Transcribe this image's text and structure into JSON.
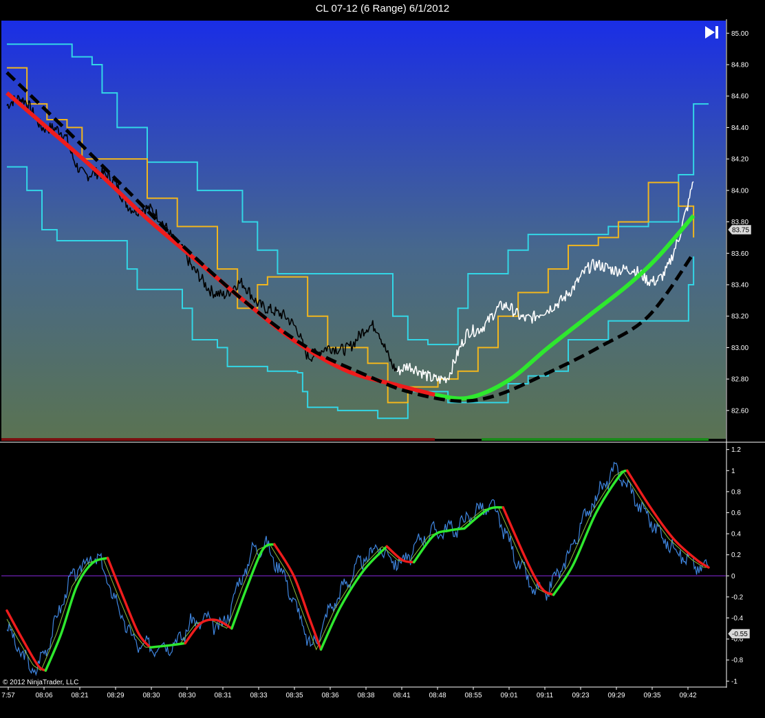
{
  "window": {
    "title": "CL 07-12 (6 Range)  6/1/2012"
  },
  "copyright": "© 2012 NinjaTrader, LLC",
  "colors": {
    "cyan": "#33d6e6",
    "orange": "#f2b61d",
    "red": "#ee1c1c",
    "green": "#2ee82e",
    "black_dash": "#000000",
    "blue_osc": "#3f86e0",
    "zero_line": "#8a2be2"
  },
  "chart_data": [
    {
      "type": "line",
      "panel": "price",
      "yticks": [
        "85.00",
        "84.80",
        "84.60",
        "84.40",
        "84.20",
        "84.00",
        "83.80",
        "83.60",
        "83.40",
        "83.20",
        "83.00",
        "82.80",
        "82.60"
      ],
      "ylim": [
        82.42,
        85.08
      ],
      "current_label": "83.75",
      "current_value": 83.75,
      "series": [
        {
          "color_key": "red",
          "role": "trend",
          "points": [
            [
              0,
              84.62
            ],
            [
              40,
              84.4
            ],
            [
              90,
              84.12
            ],
            [
              140,
              83.82
            ],
            [
              190,
              83.55
            ],
            [
              240,
              83.28
            ],
            [
              290,
              83.03
            ],
            [
              340,
              82.85
            ],
            [
              390,
              82.76
            ],
            [
              427,
              82.7
            ]
          ]
        },
        {
          "color_key": "green",
          "role": "trend",
          "points": [
            [
              427,
              82.7
            ],
            [
              460,
              82.68
            ],
            [
              500,
              82.79
            ],
            [
              540,
              83.0
            ],
            [
              580,
              83.2
            ],
            [
              620,
              83.4
            ],
            [
              650,
              83.58
            ],
            [
              685,
              83.84
            ]
          ]
        },
        {
          "color_key": "black_dash",
          "role": "trend",
          "points": [
            [
              0,
              84.75
            ],
            [
              60,
              84.38
            ],
            [
              120,
              84.0
            ],
            [
              180,
              83.62
            ],
            [
              240,
              83.28
            ],
            [
              300,
              83.0
            ],
            [
              360,
              82.82
            ],
            [
              400,
              82.72
            ],
            [
              450,
              82.66
            ],
            [
              490,
              82.7
            ],
            [
              540,
              82.84
            ],
            [
              590,
              83.0
            ],
            [
              640,
              83.2
            ],
            [
              685,
              83.6
            ]
          ]
        },
        {
          "color_key": "cyan",
          "role": "upper",
          "points": [
            [
              0,
              84.93
            ],
            [
              60,
              84.93
            ],
            [
              65,
              84.85
            ],
            [
              85,
              84.8
            ],
            [
              95,
              84.62
            ],
            [
              110,
              84.4
            ],
            [
              140,
              84.18
            ],
            [
              190,
              84.0
            ],
            [
              235,
              83.8
            ],
            [
              250,
              83.62
            ],
            [
              270,
              83.47
            ],
            [
              370,
              83.47
            ],
            [
              385,
              83.2
            ],
            [
              400,
              83.05
            ],
            [
              420,
              83.02
            ],
            [
              440,
              83.02
            ],
            [
              450,
              83.25
            ],
            [
              460,
              83.47
            ],
            [
              500,
              83.62
            ],
            [
              520,
              83.72
            ],
            [
              600,
              83.77
            ],
            [
              640,
              83.8
            ],
            [
              670,
              84.1
            ],
            [
              685,
              84.55
            ],
            [
              700,
              84.55
            ]
          ]
        },
        {
          "color_key": "cyan",
          "role": "lower",
          "points": [
            [
              0,
              84.15
            ],
            [
              20,
              84.0
            ],
            [
              35,
              83.75
            ],
            [
              50,
              83.68
            ],
            [
              110,
              83.68
            ],
            [
              120,
              83.5
            ],
            [
              130,
              83.37
            ],
            [
              160,
              83.37
            ],
            [
              175,
              83.25
            ],
            [
              185,
              83.05
            ],
            [
              210,
              83.0
            ],
            [
              220,
              82.88
            ],
            [
              260,
              82.85
            ],
            [
              290,
              82.84
            ],
            [
              295,
              82.72
            ],
            [
              300,
              82.62
            ],
            [
              330,
              82.6
            ],
            [
              370,
              82.55
            ],
            [
              390,
              82.55
            ],
            [
              400,
              82.72
            ],
            [
              440,
              82.65
            ],
            [
              480,
              82.65
            ],
            [
              500,
              82.77
            ],
            [
              520,
              82.82
            ],
            [
              540,
              82.85
            ],
            [
              560,
              83.05
            ],
            [
              600,
              83.17
            ],
            [
              660,
              83.17
            ],
            [
              680,
              83.4
            ],
            [
              685,
              83.58
            ]
          ]
        },
        {
          "color_key": "orange",
          "role": "band",
          "points": [
            [
              0,
              84.78
            ],
            [
              20,
              84.55
            ],
            [
              40,
              84.45
            ],
            [
              60,
              84.4
            ],
            [
              75,
              84.2
            ],
            [
              120,
              84.2
            ],
            [
              140,
              83.95
            ],
            [
              170,
              83.77
            ],
            [
              190,
              83.77
            ],
            [
              210,
              83.5
            ],
            [
              230,
              83.25
            ],
            [
              250,
              83.4
            ],
            [
              260,
              83.45
            ],
            [
              280,
              83.45
            ],
            [
              300,
              83.2
            ],
            [
              320,
              83.0
            ],
            [
              360,
              82.9
            ],
            [
              380,
              82.65
            ],
            [
              400,
              82.75
            ],
            [
              430,
              82.8
            ],
            [
              450,
              82.85
            ],
            [
              470,
              83.0
            ],
            [
              490,
              83.2
            ],
            [
              510,
              83.35
            ],
            [
              540,
              83.5
            ],
            [
              560,
              83.65
            ],
            [
              590,
              83.7
            ],
            [
              610,
              83.8
            ],
            [
              640,
              84.05
            ],
            [
              660,
              84.05
            ],
            [
              670,
              83.9
            ],
            [
              685,
              83.7
            ]
          ]
        }
      ]
    },
    {
      "type": "line",
      "panel": "oscillator",
      "yticks": [
        "1.2",
        "1",
        "0.8",
        "0.6",
        "0.4",
        "0.2",
        "0",
        "-0.2",
        "-0.4",
        "-0.6",
        "-0.8",
        "-1"
      ],
      "ylim": [
        -1.05,
        1.25
      ],
      "current_label": "-0.55",
      "current_value": -0.55,
      "zero": 0,
      "series": [
        {
          "color_key": "red",
          "role": "signal",
          "segments": "down",
          "points": [
            [
              0,
              -0.33
            ],
            [
              20,
              -0.6
            ],
            [
              40,
              -0.85
            ],
            [
              50,
              -0.9
            ]
          ]
        },
        {
          "color_key": "green",
          "role": "signal",
          "segments": "up",
          "points": [
            [
              50,
              -0.9
            ],
            [
              70,
              -0.55
            ],
            [
              90,
              -0.1
            ],
            [
              110,
              0.12
            ],
            [
              130,
              0.17
            ]
          ]
        },
        {
          "color_key": "red",
          "role": "signal",
          "points": [
            [
              130,
              0.17
            ],
            [
              150,
              -0.2
            ],
            [
              170,
              -0.55
            ],
            [
              185,
              -0.68
            ]
          ]
        },
        {
          "color_key": "green",
          "role": "signal",
          "points": [
            [
              185,
              -0.68
            ],
            [
              210,
              -0.66
            ],
            [
              230,
              -0.64
            ]
          ]
        },
        {
          "color_key": "red",
          "role": "signal",
          "points": [
            [
              230,
              -0.64
            ],
            [
              250,
              -0.45
            ],
            [
              270,
              -0.42
            ],
            [
              290,
              -0.5
            ]
          ]
        },
        {
          "color_key": "green",
          "role": "signal",
          "points": [
            [
              290,
              -0.5
            ],
            [
              310,
              -0.1
            ],
            [
              330,
              0.25
            ],
            [
              345,
              0.3
            ]
          ]
        },
        {
          "color_key": "red",
          "role": "signal",
          "points": [
            [
              345,
              0.3
            ],
            [
              370,
              0.0
            ],
            [
              390,
              -0.4
            ],
            [
              405,
              -0.7
            ]
          ]
        },
        {
          "color_key": "green",
          "role": "signal",
          "points": [
            [
              405,
              -0.7
            ],
            [
              430,
              -0.3
            ],
            [
              460,
              0.05
            ],
            [
              490,
              0.28
            ]
          ]
        },
        {
          "color_key": "red",
          "role": "signal",
          "points": [
            [
              490,
              0.28
            ],
            [
              510,
              0.15
            ],
            [
              525,
              0.13
            ]
          ]
        },
        {
          "color_key": "green",
          "role": "signal",
          "points": [
            [
              525,
              0.13
            ],
            [
              550,
              0.38
            ],
            [
              570,
              0.43
            ],
            [
              590,
              0.45
            ]
          ]
        },
        {
          "color_key": "green",
          "role": "signal",
          "points": [
            [
              590,
              0.45
            ],
            [
              620,
              0.63
            ],
            [
              640,
              0.65
            ]
          ]
        },
        {
          "color_key": "red",
          "role": "signal",
          "points": [
            [
              640,
              0.65
            ],
            [
              670,
              0.15
            ],
            [
              690,
              -0.12
            ],
            [
              705,
              -0.18
            ]
          ]
        },
        {
          "color_key": "green",
          "role": "signal",
          "points": [
            [
              705,
              -0.18
            ],
            [
              730,
              0.1
            ],
            [
              760,
              0.6
            ],
            [
              790,
              0.95
            ],
            [
              800,
              1.0
            ]
          ]
        },
        {
          "color_key": "red",
          "role": "signal",
          "points": [
            [
              800,
              1.0
            ],
            [
              830,
              0.65
            ],
            [
              860,
              0.35
            ],
            [
              890,
              0.15
            ],
            [
              905,
              0.08
            ]
          ]
        }
      ]
    }
  ],
  "xticks": [
    "7:57",
    "08:06",
    "08:21",
    "08:29",
    "08:30",
    "08:30",
    "08:31",
    "08:33",
    "08:35",
    "08:36",
    "08:38",
    "08:41",
    "08:48",
    "08:55",
    "09:01",
    "09:11",
    "09:23",
    "09:29",
    "09:35",
    "09:42"
  ]
}
